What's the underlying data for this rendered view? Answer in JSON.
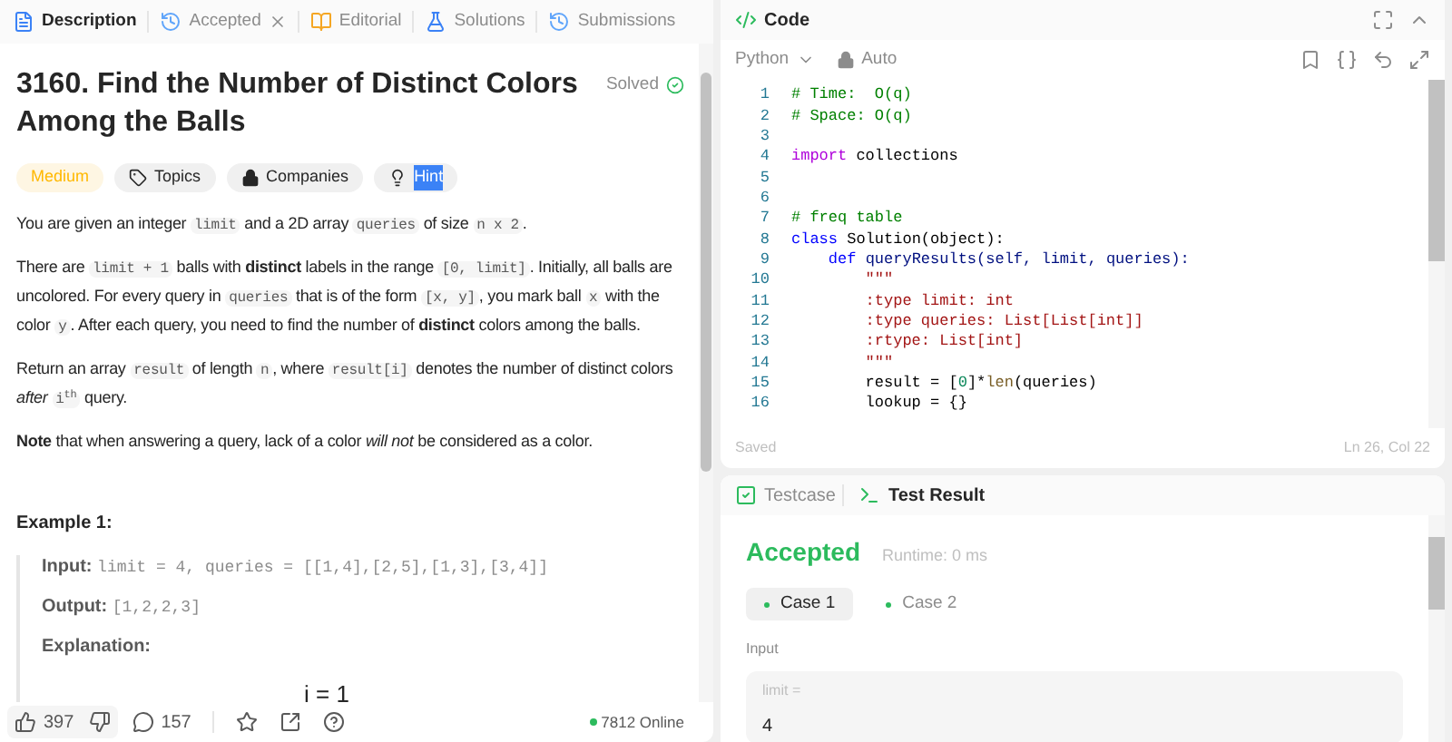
{
  "left_tabs": [
    {
      "kind": "description",
      "label": "Description",
      "selected": true,
      "closable": false
    },
    {
      "kind": "history",
      "label": "Accepted",
      "selected": false,
      "closable": true
    },
    {
      "kind": "editorial",
      "label": "Editorial",
      "selected": false,
      "closable": false
    },
    {
      "kind": "solutions",
      "label": "Solutions",
      "selected": false,
      "closable": false
    },
    {
      "kind": "history",
      "label": "Submissions",
      "selected": false,
      "closable": false
    }
  ],
  "problem": {
    "title": "3160. Find the Number of Distinct Colors Among the Balls",
    "status": "Solved",
    "chips": [
      {
        "kind": "difficulty",
        "label": "Medium"
      },
      {
        "kind": "topics",
        "label": "Topics"
      },
      {
        "kind": "companies",
        "label": "Companies"
      },
      {
        "kind": "hint",
        "label": "Hint",
        "text_selected": true
      }
    ],
    "paragraphs": [
      [
        {
          "kind": "text",
          "text": "You are given an integer "
        },
        {
          "kind": "code",
          "text": "limit"
        },
        {
          "kind": "text",
          "text": " and a 2D array "
        },
        {
          "kind": "code",
          "text": "queries"
        },
        {
          "kind": "text",
          "text": " of size "
        },
        {
          "kind": "code",
          "text": "n x 2"
        },
        {
          "kind": "text",
          "text": "."
        }
      ],
      [
        {
          "kind": "text",
          "text": "There are "
        },
        {
          "kind": "code",
          "text": "limit + 1"
        },
        {
          "kind": "text",
          "text": " balls with **distinct** labels in the range "
        },
        {
          "kind": "code",
          "text": "[0, limit]"
        },
        {
          "kind": "text",
          "text": ". Initially, all balls are uncolored. For every query in "
        },
        {
          "kind": "code",
          "text": "queries"
        },
        {
          "kind": "text",
          "text": " that is of the form "
        },
        {
          "kind": "code",
          "text": "[x, y]"
        },
        {
          "kind": "text",
          "text": ", you mark ball "
        },
        {
          "kind": "code",
          "text": "x"
        },
        {
          "kind": "text",
          "text": " with the color "
        },
        {
          "kind": "code",
          "text": "y"
        },
        {
          "kind": "text",
          "text": ". After each query, you need to find the number of **distinct** colors among the balls."
        }
      ],
      [
        {
          "kind": "text",
          "text": "Return an array "
        },
        {
          "kind": "code",
          "text": "result"
        },
        {
          "kind": "text",
          "text": " of length "
        },
        {
          "kind": "code",
          "text": "n"
        },
        {
          "kind": "text",
          "text": ", where "
        },
        {
          "kind": "code",
          "text": "result[i]"
        },
        {
          "kind": "text",
          "text": " denotes the number of distinct colors *after* "
        },
        {
          "kind": "code",
          "text": "i$^{th}$"
        },
        {
          "kind": "text",
          "text": " query."
        }
      ],
      [
        {
          "kind": "text",
          "text": "**Note** that when answering a query, lack of a color *will not* be considered as a color."
        }
      ]
    ],
    "example": {
      "title": "Example 1:",
      "items": [
        {
          "label": "Input:",
          "value": "limit = 4, queries = [[1,4],[2,5],[1,3],[3,4]]"
        },
        {
          "label": "Output:",
          "value": "[1,2,2,3]"
        },
        {
          "label": "Explanation:"
        }
      ],
      "illustration_label": "i = 1"
    }
  },
  "stats": {
    "likes": "397",
    "comments": "157",
    "online": "7812 Online"
  },
  "code_panel": {
    "title": "Code",
    "language": "Python",
    "mode": "Auto",
    "status": "Saved",
    "cursor": "Ln 26, Col 22",
    "lines": [
      {
        "number": "1",
        "tokens": [
          {
            "kind": "comment",
            "text": "# Time:  O(q)"
          }
        ]
      },
      {
        "number": "2",
        "tokens": [
          {
            "kind": "comment",
            "text": "# Space: O(q)"
          }
        ]
      },
      {
        "number": "3"
      },
      {
        "number": "4",
        "tokens": [
          {
            "kind": "keyword",
            "text": "import"
          },
          {
            "kind": "plain",
            "text": " collections"
          }
        ]
      },
      {
        "number": "5"
      },
      {
        "number": "6"
      },
      {
        "number": "7",
        "tokens": [
          {
            "kind": "comment",
            "text": "# freq table"
          }
        ]
      },
      {
        "number": "8",
        "tokens": [
          {
            "kind": "decl",
            "text": "class"
          },
          {
            "kind": "plain",
            "text": " Solution(object):"
          }
        ]
      },
      {
        "number": "9",
        "tokens": [
          {
            "kind": "decl",
            "text": "    def"
          },
          {
            "kind": "func",
            "text": " queryResults(self, limit, queries):"
          }
        ]
      },
      {
        "number": "10",
        "tokens": [
          {
            "kind": "string",
            "text": "        \"\"\""
          }
        ]
      },
      {
        "number": "11",
        "tokens": [
          {
            "kind": "string",
            "text": "        :type limit: int"
          }
        ]
      },
      {
        "number": "12",
        "tokens": [
          {
            "kind": "string",
            "text": "        :type queries: List[List[int]]"
          }
        ]
      },
      {
        "number": "13",
        "tokens": [
          {
            "kind": "string",
            "text": "        :rtype: List[int]"
          }
        ]
      },
      {
        "number": "14",
        "tokens": [
          {
            "kind": "string",
            "text": "        \"\"\""
          }
        ]
      },
      {
        "number": "15",
        "tokens": [
          {
            "kind": "plain",
            "text": "        result = ["
          },
          {
            "kind": "number",
            "text": "0"
          },
          {
            "kind": "plain",
            "text": "]*"
          },
          {
            "kind": "builtin",
            "text": "len"
          },
          {
            "kind": "plain",
            "text": "(queries)"
          }
        ]
      },
      {
        "number": "16",
        "tokens": [
          {
            "kind": "plain",
            "text": "        lookup = {}"
          }
        ]
      }
    ]
  },
  "result_panel": {
    "tabs": [
      {
        "kind": "testcase",
        "label": "Testcase",
        "selected": false
      },
      {
        "kind": "result",
        "label": "Test Result",
        "selected": true
      }
    ],
    "verdict": "Accepted",
    "runtime": "Runtime: 0 ms",
    "cases": [
      {
        "label": "Case 1",
        "selected": true,
        "color": "#2cbb5d"
      },
      {
        "label": "Case 2",
        "selected": false,
        "color": "#2cbb5d"
      }
    ],
    "section": "Input",
    "fields": [
      {
        "name": "limit =",
        "value": "4"
      }
    ]
  }
}
